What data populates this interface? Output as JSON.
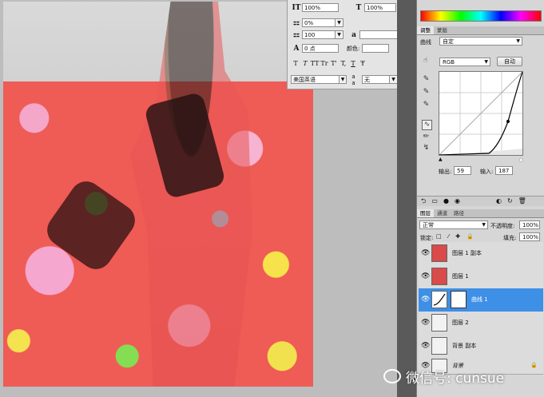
{
  "character_panel": {
    "scale_vertical": "100%",
    "scale_horizontal": "100%",
    "tracking": "0%",
    "kerning": "100",
    "baseline_shift": "0 点",
    "color_label": "颜色:",
    "language": "美国英语",
    "antialias_icon_label": "a a",
    "antialias": "无",
    "style_buttons": [
      "T",
      "T",
      "TT",
      "Tr",
      "T'",
      "T,",
      "T",
      "Ŧ"
    ]
  },
  "adjustments": {
    "tabs": [
      "调整",
      "蒙版"
    ],
    "preset_label": "曲线",
    "preset_value": "自定",
    "channel": "RGB",
    "auto_button": "自动",
    "output_label": "输出:",
    "output_value": "59",
    "input_label": "输入:",
    "input_value": "187"
  },
  "layers_panel": {
    "tabs": [
      "图层",
      "通道",
      "路径"
    ],
    "blend_mode": "正常",
    "opacity_label": "不透明度:",
    "opacity_value": "100%",
    "lock_label": "锁定:",
    "fill_label": "填充:",
    "fill_value": "100%",
    "layers": [
      {
        "name": "图层 1 副本",
        "selected": false
      },
      {
        "name": "图层 1",
        "selected": false
      },
      {
        "name": "曲线 1",
        "selected": true
      },
      {
        "name": "图层 2",
        "selected": false
      },
      {
        "name": "背景 副本",
        "selected": false
      },
      {
        "name": "背景",
        "selected": false
      }
    ]
  },
  "watermark": {
    "text": "微信号: cunsue"
  },
  "colors": {
    "selection": "#3e8fe6",
    "floral_red": "#ef5b55"
  }
}
